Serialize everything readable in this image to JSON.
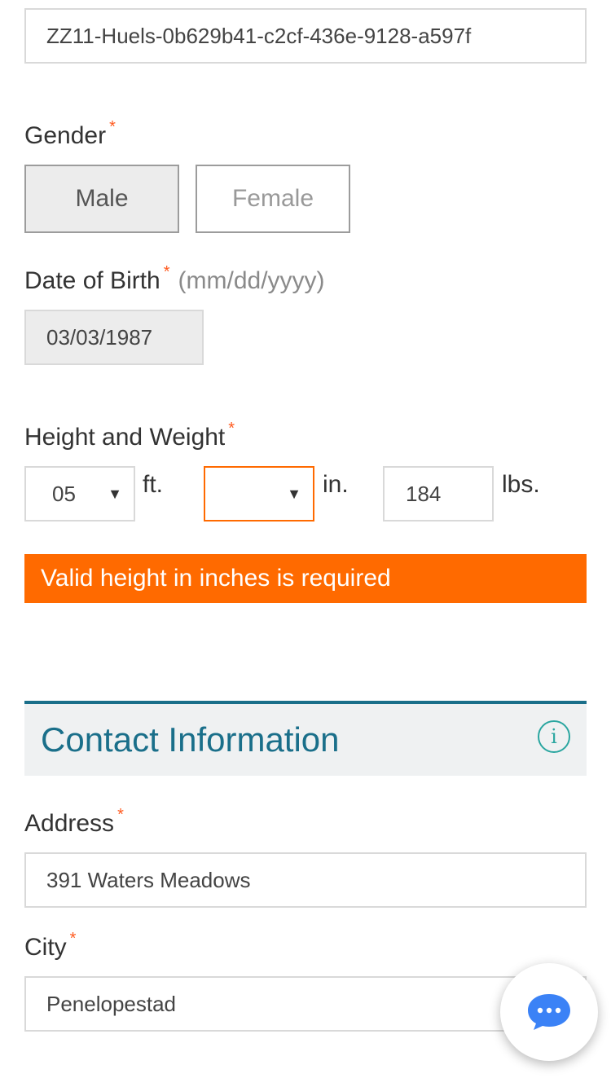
{
  "id_field": {
    "value": "ZZ11-Huels-0b629b41-c2cf-436e-9128-a597f"
  },
  "gender": {
    "label": "Gender",
    "options": [
      "Male",
      "Female"
    ]
  },
  "dob": {
    "label": "Date of Birth",
    "hint": "(mm/dd/yyyy)",
    "value": "03/03/1987"
  },
  "height_weight": {
    "label": "Height and Weight",
    "feet_value": "05",
    "feet_unit": "ft.",
    "inches_value": "",
    "inches_unit": "in.",
    "weight_value": "184",
    "weight_unit": "lbs.",
    "error": "Valid height in inches is required"
  },
  "contact": {
    "title": "Contact Information"
  },
  "address": {
    "label": "Address",
    "value": "391 Waters Meadows"
  },
  "city": {
    "label": "City",
    "value": "Penelopestad"
  },
  "required_marker": "*",
  "colors": {
    "accent": "#ff6a00",
    "teal": "#1a6f8a",
    "chat": "#3b82f6"
  }
}
